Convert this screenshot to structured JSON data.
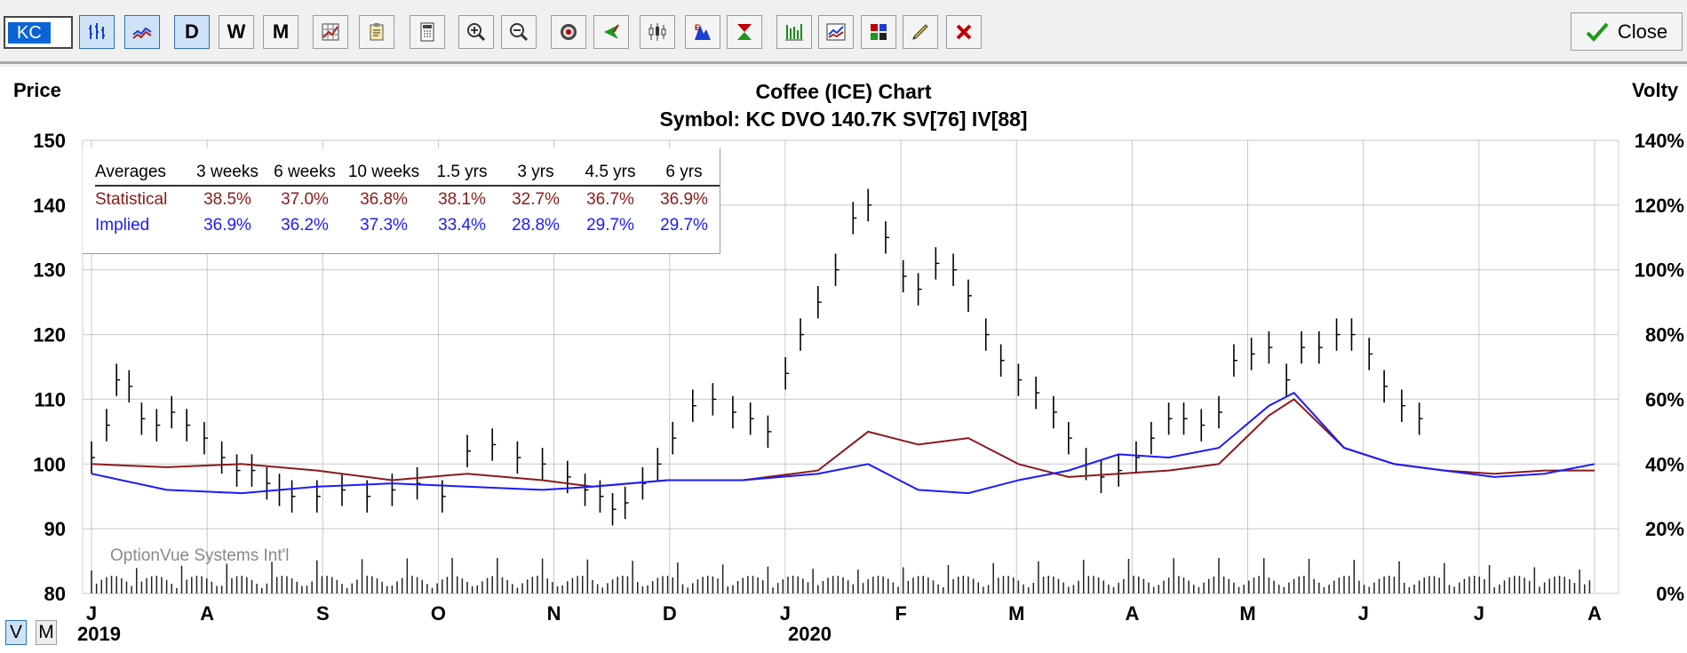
{
  "toolbar": {
    "symbol": "KC",
    "period_buttons": [
      "D",
      "W",
      "M"
    ],
    "close_label": "Close",
    "colors": {
      "selected": "#cfe3f7",
      "close_check": "#1a9a1a",
      "delete_x": "#c00000"
    }
  },
  "chart_data": {
    "type": "line",
    "title": "Coffee (ICE) Chart",
    "subtitle": "Symbol: KC  DVO 140.7K  SV[76]  IV[88]",
    "left_axis": {
      "label": "Price",
      "ticks": [
        150,
        140,
        130,
        120,
        110,
        100,
        90,
        80
      ],
      "range": [
        80,
        150
      ]
    },
    "right_axis": {
      "label": "Volty",
      "ticks": [
        "140%",
        "120%",
        "100%",
        "80%",
        "60%",
        "40%",
        "20%",
        "0%"
      ],
      "range": [
        0,
        140
      ]
    },
    "x_month_labels": [
      "J",
      "A",
      "S",
      "O",
      "N",
      "D",
      "J",
      "F",
      "M",
      "A",
      "M",
      "J",
      "J",
      "A"
    ],
    "year_labels": [
      "2019",
      "2020"
    ],
    "grid": true,
    "watermark": "OptionVue Systems Int'l",
    "price_series": {
      "name": "KC price bars",
      "color": "#000000",
      "x": [
        0,
        6,
        10,
        15,
        20,
        26,
        32,
        38,
        45,
        52,
        58,
        64,
        70,
        75,
        80,
        90,
        100,
        110,
        120,
        130,
        140,
        150,
        160,
        170,
        180,
        190,
        197,
        203,
        208,
        213,
        220,
        226,
        232,
        240,
        248,
        256,
        263,
        270,
        277,
        283,
        290,
        297,
        304,
        310,
        317,
        324,
        330,
        337,
        344,
        350,
        357,
        363,
        370,
        377,
        384,
        390,
        397,
        403,
        410,
        417,
        423,
        430,
        436,
        443,
        450,
        456,
        463,
        470,
        477,
        483,
        490,
        497,
        503,
        510,
        516,
        523,
        530
      ],
      "values": [
        101,
        106,
        113,
        112,
        107,
        106,
        108,
        106,
        104,
        101,
        99,
        99,
        97,
        96,
        95,
        95,
        96,
        95,
        96,
        97,
        95,
        102,
        103,
        101,
        100,
        98,
        96,
        95,
        93,
        94,
        97,
        100,
        104,
        109,
        110,
        108,
        107,
        105,
        114,
        120,
        125,
        130,
        138,
        140,
        135,
        129,
        127,
        131,
        130,
        126,
        120,
        116,
        113,
        111,
        108,
        104,
        100,
        98,
        99,
        101,
        104,
        107,
        107,
        106,
        108,
        116,
        117,
        118,
        113,
        118,
        118,
        120,
        120,
        117,
        112,
        109,
        107
      ]
    },
    "statistical_volatility": {
      "name": "Statistical",
      "color": "#8b1a1a",
      "x": [
        0,
        30,
        60,
        90,
        120,
        150,
        180,
        200,
        230,
        260,
        290,
        310,
        330,
        350,
        370,
        390,
        410,
        430,
        450,
        470,
        480,
        500,
        520,
        540,
        560,
        580,
        600
      ],
      "values": [
        40,
        39,
        40,
        38,
        35,
        37,
        35,
        33,
        35,
        35,
        38,
        50,
        46,
        48,
        40,
        36,
        37,
        38,
        40,
        55,
        60,
        45,
        40,
        38,
        37,
        38,
        38
      ]
    },
    "implied_volatility": {
      "name": "Implied",
      "color": "#1a1aff",
      "x": [
        0,
        30,
        60,
        90,
        120,
        150,
        180,
        200,
        230,
        260,
        290,
        310,
        330,
        350,
        370,
        390,
        410,
        430,
        450,
        470,
        480,
        500,
        520,
        540,
        560,
        580,
        600
      ],
      "values": [
        37,
        32,
        31,
        33,
        34,
        33,
        32,
        33,
        35,
        35,
        37,
        40,
        32,
        31,
        35,
        38,
        43,
        42,
        45,
        58,
        62,
        45,
        40,
        38,
        36,
        37,
        40
      ]
    },
    "volume_note": "Volume bars shown at bottom"
  },
  "averages_table": {
    "header": [
      "Averages",
      "3 weeks",
      "6 weeks",
      "10 weeks",
      "1.5 yrs",
      "3 yrs",
      "4.5 yrs",
      "6 yrs"
    ],
    "rows": [
      {
        "label": "Statistical",
        "color": "#8b1a1a",
        "values": [
          "38.5%",
          "37.0%",
          "36.8%",
          "38.1%",
          "32.7%",
          "36.7%",
          "36.9%"
        ]
      },
      {
        "label": "Implied",
        "color": "#1a1aff",
        "values": [
          "36.9%",
          "36.2%",
          "37.3%",
          "33.4%",
          "28.8%",
          "29.7%",
          "29.7%"
        ]
      }
    ]
  },
  "view_toggle": {
    "v": "V",
    "m": "M"
  }
}
